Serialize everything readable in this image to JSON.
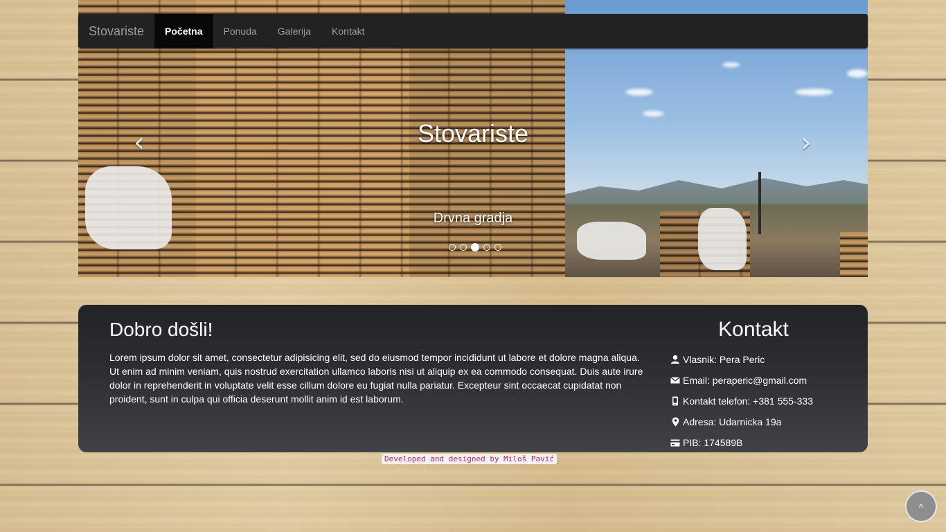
{
  "navbar": {
    "brand": "Stovariste",
    "items": [
      {
        "label": "Početna",
        "active": true
      },
      {
        "label": "Ponuda",
        "active": false
      },
      {
        "label": "Galerija",
        "active": false
      },
      {
        "label": "Kontakt",
        "active": false
      }
    ]
  },
  "hero": {
    "title": "Stovariste",
    "subtitle": "Drvna gradja",
    "prev_icon": "chevron-left-icon",
    "next_icon": "chevron-right-icon",
    "slides_count": 5,
    "active_slide": 3
  },
  "welcome": {
    "heading": "Dobro došli!",
    "text": "Lorem ipsum dolor sit amet, consectetur adipisicing elit, sed do eiusmod tempor incididunt ut labore et dolore magna aliqua. Ut enim ad minim veniam, quis nostrud exercitation ullamco laboris nisi ut aliquip ex ea commodo consequat. Duis aute irure dolor in reprehenderit in voluptate velit esse cillum dolore eu fugiat nulla pariatur. Excepteur sint occaecat cupidatat non proident, sunt in culpa qui officia deserunt mollit anim id est laborum."
  },
  "contact": {
    "heading": "Kontakt",
    "owner": "Vlasnik: Pera Peric",
    "email": "Email: peraperic@gmail.com",
    "phone": "Kontakt telefon: +381 555-333",
    "address": "Adresa: Udarnicka 19a",
    "pib": "PIB: 174589B"
  },
  "footer": {
    "credit": "Developed and designed by Miloš Pavić"
  },
  "back_to_top": {
    "label": "^"
  }
}
